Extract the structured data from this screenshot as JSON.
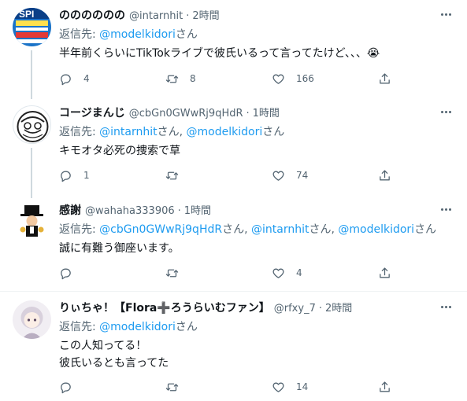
{
  "replies": [
    {
      "name": "のののののの",
      "handle": "@intarnhit",
      "time": "2時間",
      "reply_prefix": "返信先: ",
      "mentions": [
        {
          "text": "@modelkidori",
          "suffix": "さん"
        }
      ],
      "text": "半年前くらいにTikTokライブで彼氏いるって言ってたけど、、、😭",
      "reply_count": "4",
      "retweet_count": "8",
      "like_count": "166"
    },
    {
      "name": "コージまんじ",
      "handle": "@cbGn0GWwRj9qHdR",
      "time": "1時間",
      "reply_prefix": "返信先: ",
      "mentions": [
        {
          "text": "@intarnhit",
          "suffix": "さん, "
        },
        {
          "text": "@modelkidori",
          "suffix": "さん"
        }
      ],
      "text": "キモオタ必死の捜索で草",
      "reply_count": "1",
      "retweet_count": "",
      "like_count": "74"
    },
    {
      "name": "感謝",
      "handle": "@wahaha333906",
      "time": "1時間",
      "reply_prefix": "返信先: ",
      "mentions": [
        {
          "text": "@cbGn0GWwRj9qHdR",
          "suffix": "さん, "
        },
        {
          "text": "@intarnhit",
          "suffix": "さん, "
        },
        {
          "text": "@modelkidori",
          "suffix": "さん"
        }
      ],
      "text": "誠に有難う御座います。",
      "reply_count": "",
      "retweet_count": "",
      "like_count": "4"
    },
    {
      "name": "りぃちゃ！【Flora➕ろうらいむファン】",
      "handle": "@rfxy_7",
      "time": "2時間",
      "reply_prefix": "返信先: ",
      "mentions": [
        {
          "text": "@modelkidori",
          "suffix": "さん"
        }
      ],
      "text": "この人知ってる！\n彼氏いるとも言ってた",
      "reply_count": "",
      "retweet_count": "",
      "like_count": "14"
    }
  ]
}
